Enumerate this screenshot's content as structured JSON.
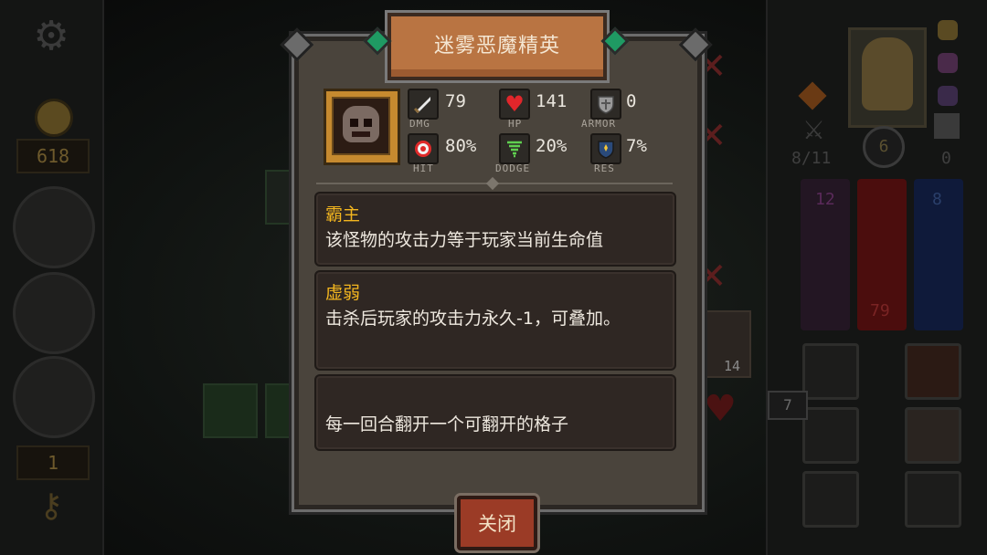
{
  "hud": {
    "gold": "618",
    "level": "1",
    "cards": "8/11",
    "rank_badge": "6",
    "shield_count": "0",
    "purple_bar": "12",
    "red_bar": "79",
    "blue_bar": "8",
    "key_count": "7",
    "item_count": "14"
  },
  "modal": {
    "title": "迷雾恶魔精英",
    "stats": {
      "dmg": {
        "value": "79",
        "label": "DMG"
      },
      "hp": {
        "value": "141",
        "label": "HP"
      },
      "armor": {
        "value": "0",
        "label": "ARMOR"
      },
      "hit": {
        "value": "80%",
        "label": "HIT"
      },
      "dodge": {
        "value": "20%",
        "label": "DODGE"
      },
      "res": {
        "value": "7%",
        "label": "RES"
      }
    },
    "abilities": [
      {
        "name": "霸主",
        "desc": "该怪物的攻击力等于玩家当前生命值"
      },
      {
        "name": "虚弱",
        "desc": "击杀后玩家的攻击力永久-1，可叠加。"
      },
      {
        "name": "",
        "desc": "每一回合翻开一个可翻开的格子"
      }
    ],
    "close_label": "关闭"
  },
  "icons": [
    "gear-icon",
    "coin-icon",
    "shield-icon",
    "helmet-icon",
    "sword-icon",
    "key-icon",
    "dmg-sword-icon",
    "hp-heart-icon",
    "armor-shield-icon",
    "hit-target-icon",
    "dodge-tornado-icon",
    "res-shield-icon",
    "skull-icon",
    "lock-icon",
    "cross-icon"
  ],
  "colors": {
    "accent_gold": "#f3b61f",
    "banner": "#b97442",
    "close": "#9b3b26",
    "hp_red": "#c41818",
    "mana_blue": "#1e3a8a"
  }
}
